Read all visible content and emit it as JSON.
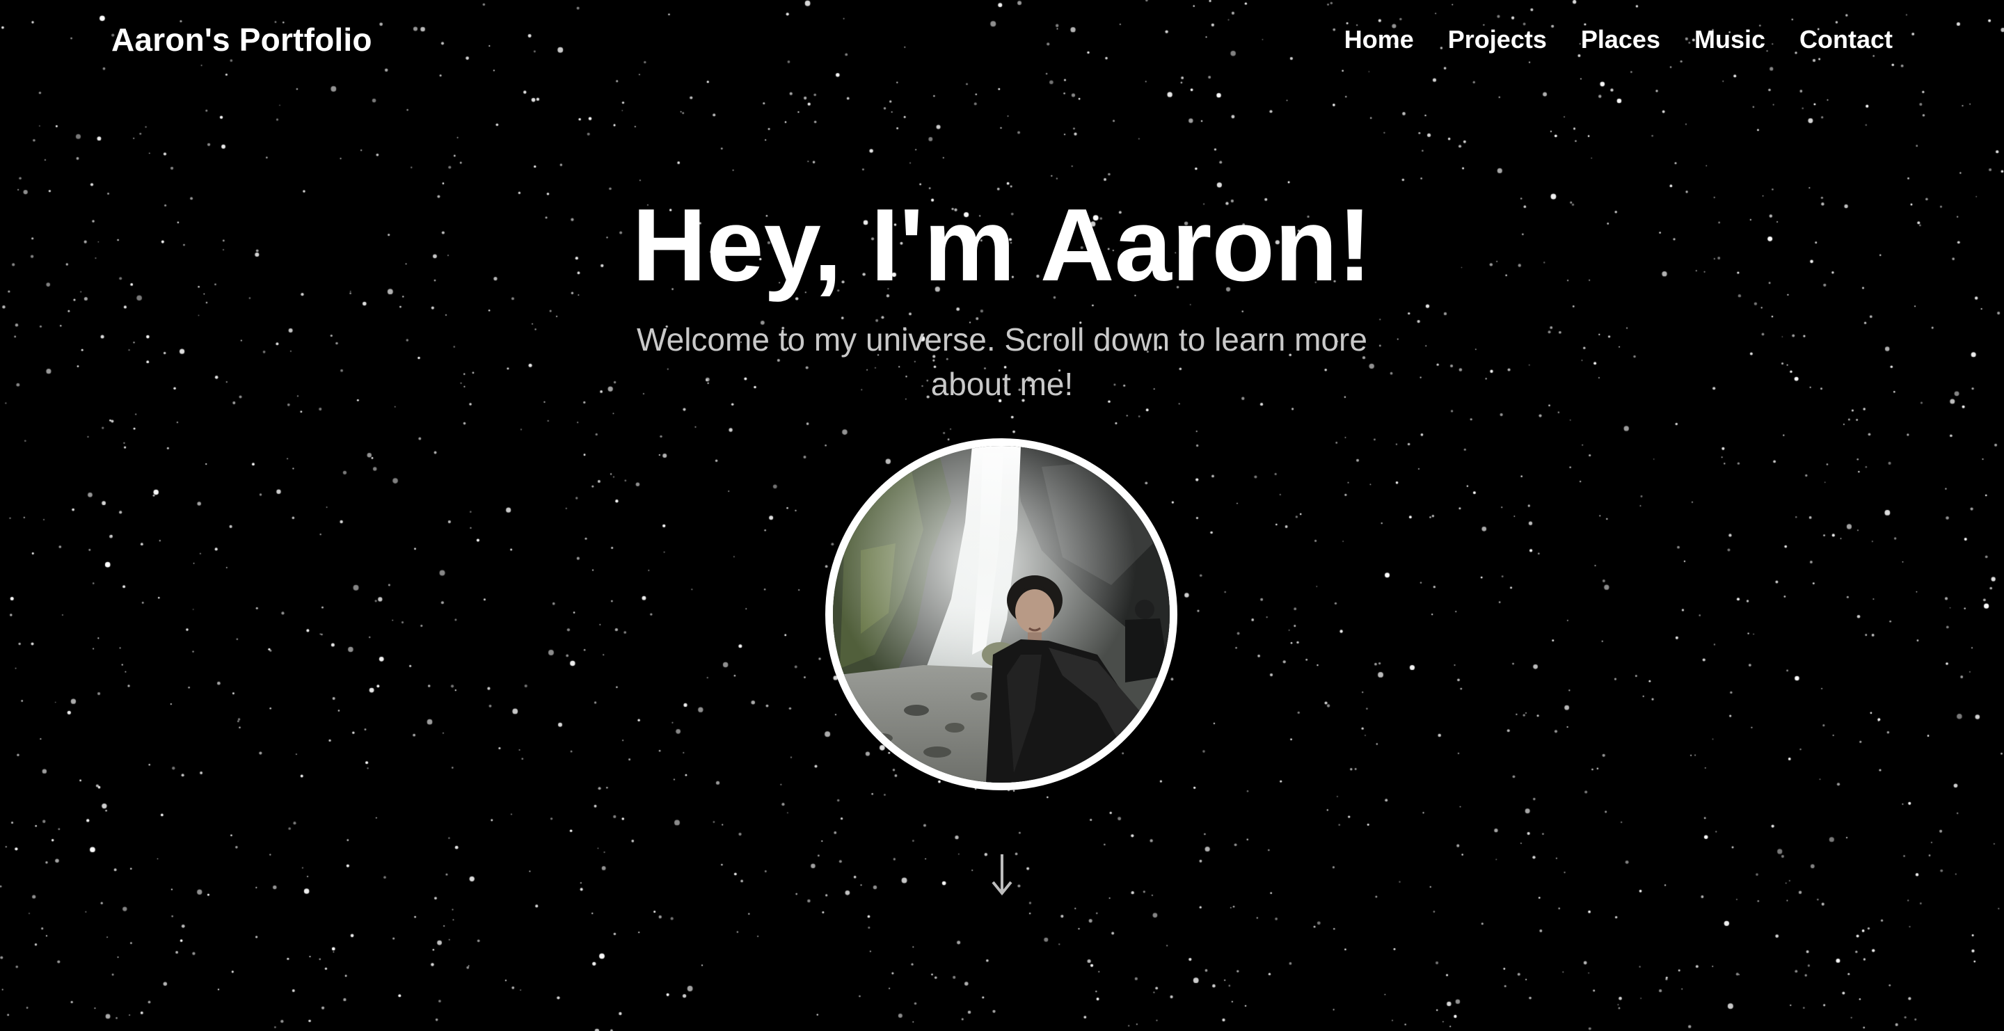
{
  "header": {
    "logo_text": "Aaron's Portfolio",
    "nav": [
      {
        "label": "Home"
      },
      {
        "label": "Projects"
      },
      {
        "label": "Places"
      },
      {
        "label": "Music"
      },
      {
        "label": "Contact"
      }
    ]
  },
  "hero": {
    "title": "Hey, I'm Aaron!",
    "subtitle": "Welcome to my universe. Scroll down to learn more about me!",
    "profile_photo": {
      "subject": "selfie-at-waterfall-cave"
    },
    "scroll_indicator_icon": "arrow-down-icon"
  },
  "colors": {
    "background": "#000000",
    "text_primary": "#ffffff",
    "text_secondary": "#c9c9c9",
    "star": "#ffffff",
    "scroll_arrow": "#bdbdbd"
  }
}
